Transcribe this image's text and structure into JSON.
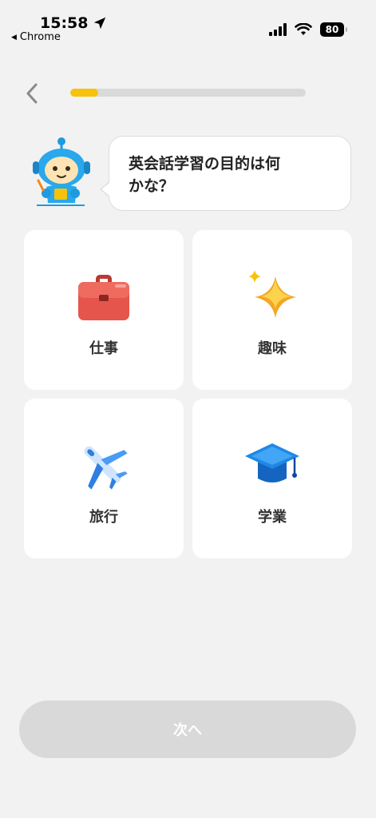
{
  "status_bar": {
    "time": "15:58",
    "back_app": "Chrome",
    "battery": "80"
  },
  "header": {
    "progress": 0.12,
    "progress_color": "#f6c30a"
  },
  "prompt": {
    "line1": "英会話学習の目的は何",
    "line2": "かな？"
  },
  "options": [
    {
      "label": "仕事",
      "icon": "briefcase-icon"
    },
    {
      "label": "趣味",
      "icon": "sparkle-icon"
    },
    {
      "label": "旅行",
      "icon": "airplane-icon"
    },
    {
      "label": "学業",
      "icon": "graduation-cap-icon"
    }
  ],
  "footer": {
    "next_label": "次へ"
  }
}
